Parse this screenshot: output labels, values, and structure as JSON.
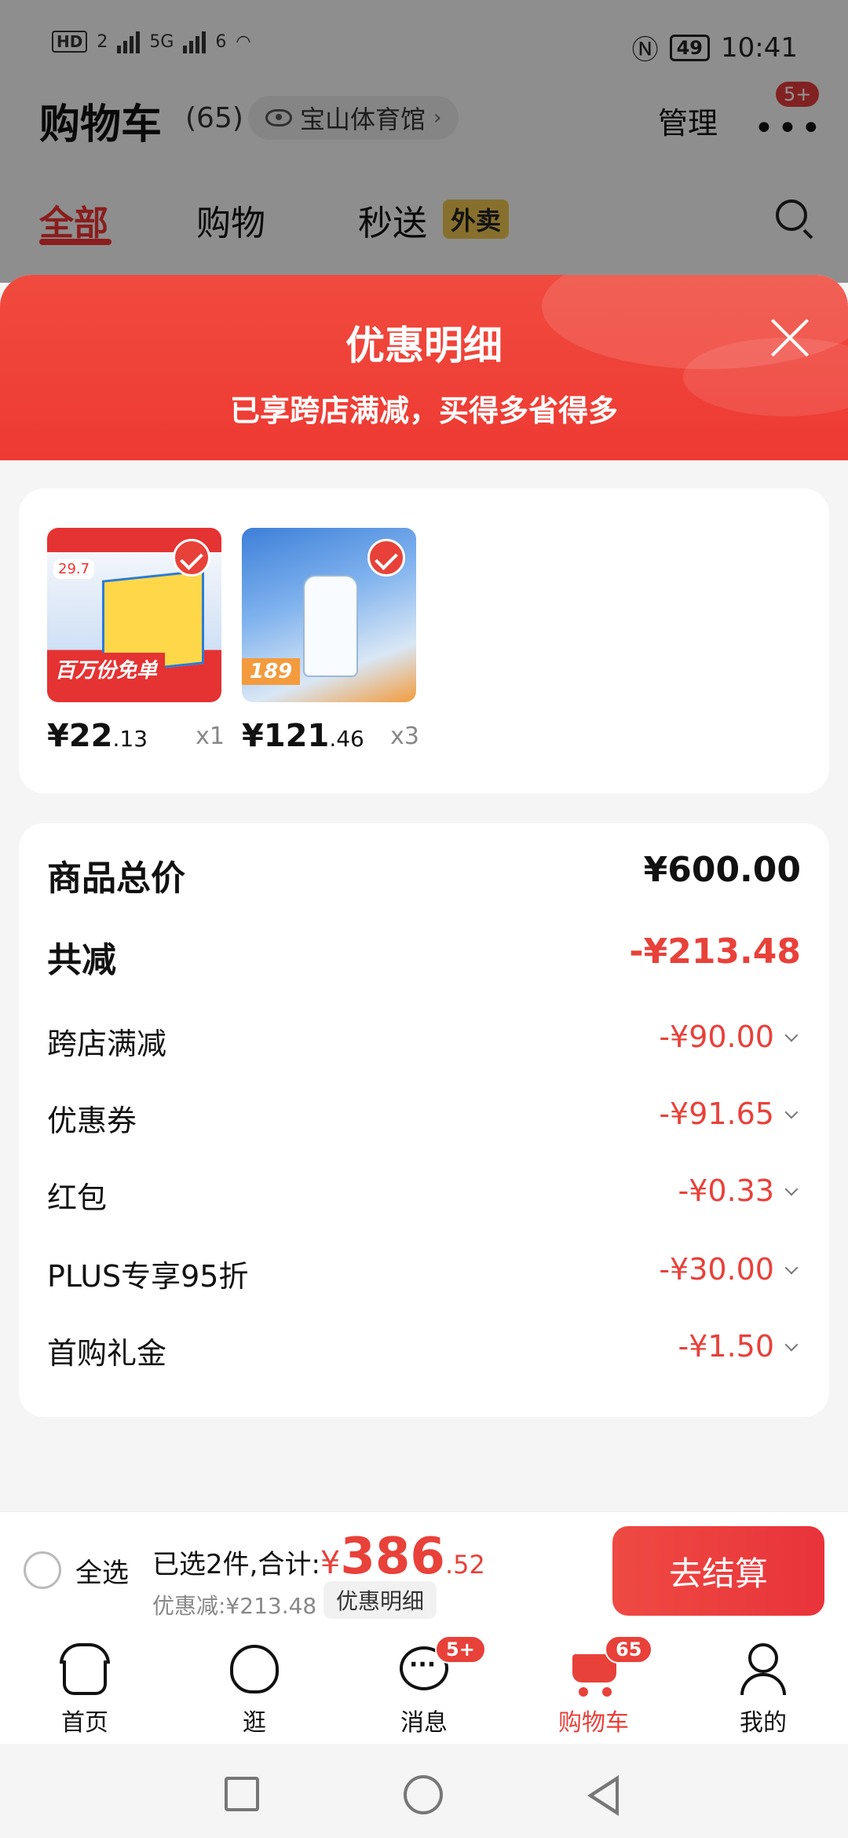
{
  "status_bar": {
    "left": [
      "HD",
      "2",
      "5G",
      "6"
    ],
    "battery": "49",
    "time": "10:41"
  },
  "cart": {
    "title": "购物车",
    "count": "(65)",
    "location": "宝山体育馆",
    "manage": "管理",
    "more_badge": "5+",
    "tabs": [
      {
        "label": "全部",
        "active": true
      },
      {
        "label": "购物",
        "active": false
      },
      {
        "label": "秒送",
        "active": false
      }
    ],
    "takeout_badge": "外卖"
  },
  "sheet": {
    "title": "优惠明细",
    "subtitle": "已享跨店满减，买得多省得多"
  },
  "products": [
    {
      "thumb_banner": "百万份免单",
      "price_int": "¥22",
      "price_dec": ".13",
      "qty": "x1"
    },
    {
      "thumb_banner": "189",
      "price_int": "¥121",
      "price_dec": ".46",
      "qty": "x3"
    }
  ],
  "detail": {
    "total_label": "商品总价",
    "total_value": "¥600.00",
    "reduce_label": "共减",
    "reduce_value": "-¥213.48",
    "items": [
      {
        "label": "跨店满减",
        "value": "-¥90.00"
      },
      {
        "label": "优惠券",
        "value": "-¥91.65"
      },
      {
        "label": "红包",
        "value": "-¥0.33"
      },
      {
        "label": "PLUS专享95折",
        "value": "-¥30.00"
      },
      {
        "label": "首购礼金",
        "value": "-¥1.50"
      }
    ]
  },
  "checkout": {
    "select_all": "全选",
    "selected_text": "已选2件,合计:",
    "currency": "¥",
    "total_int": "386",
    "total_dec": ".52",
    "discount_text": "优惠减:¥213.48",
    "detail_chip": "优惠明细",
    "button": "去结算"
  },
  "tab_bar": {
    "items": [
      {
        "label": "首页",
        "active": false
      },
      {
        "label": "逛",
        "active": false
      },
      {
        "label": "消息",
        "active": false,
        "badge": "5+"
      },
      {
        "label": "购物车",
        "active": true,
        "badge": "65"
      },
      {
        "label": "我的",
        "active": false
      }
    ]
  },
  "colors": {
    "accent": "#e8413a",
    "header_red": "#ee3a33",
    "takeout_yellow": "#e8c24e"
  }
}
